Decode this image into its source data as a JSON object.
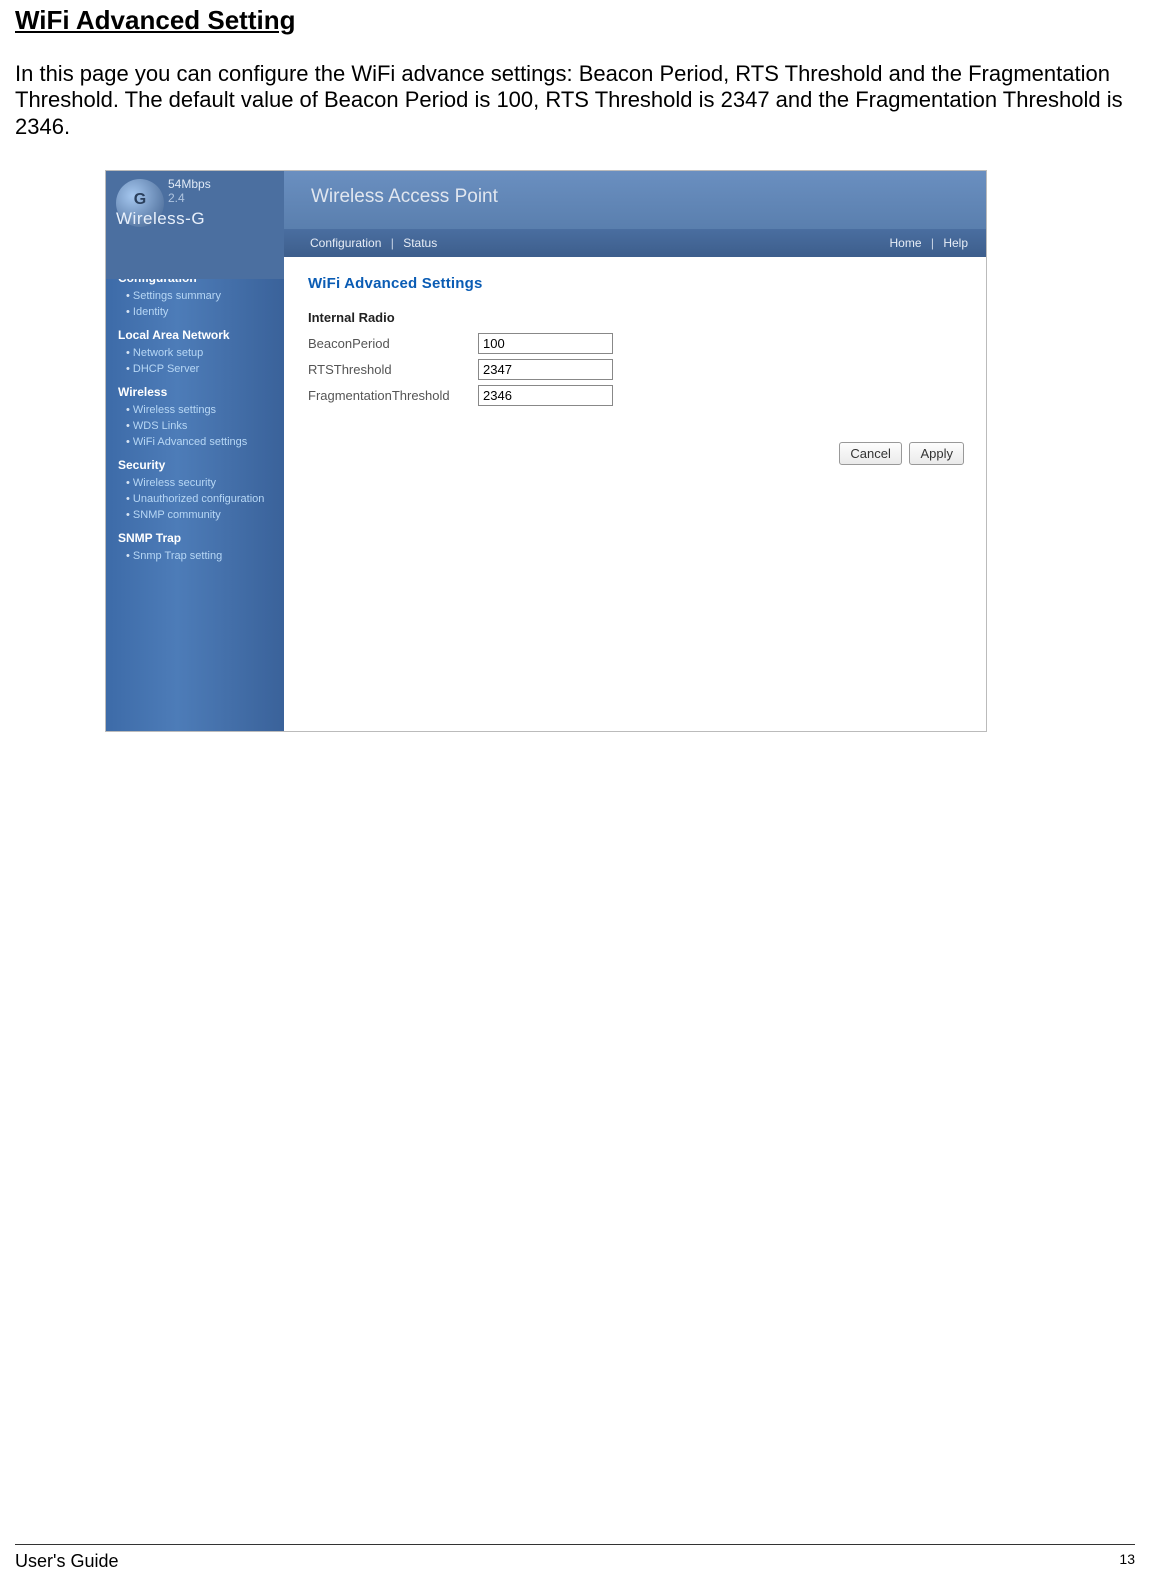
{
  "doc": {
    "title": "WiFi Advanced Setting",
    "description": "In this page you can configure the WiFi advance settings: Beacon Period, RTS Threshold and the Fragmentation Threshold. The default value of Beacon Period is 100, RTS Threshold is 2347 and the Fragmentation Threshold is 2346."
  },
  "screenshot": {
    "header": {
      "product_title": "Wireless Access Point",
      "logo_speed": "54Mbps",
      "logo_band": "2.4",
      "logo_name": "Wireless-G"
    },
    "nav": {
      "left1": "Configuration",
      "left2": "Status",
      "right1": "Home",
      "right2": "Help",
      "sep": "|"
    },
    "sidebar": {
      "sec_config": "Configuration",
      "link_settings_summary": "Settings summary",
      "link_identity": "Identity",
      "sec_lan": "Local Area Network",
      "link_network_setup": "Network setup",
      "link_dhcp": "DHCP Server",
      "sec_wireless": "Wireless",
      "link_wireless_settings": "Wireless settings",
      "link_wds": "WDS Links",
      "link_wifi_adv": "WiFi Advanced settings",
      "sec_security": "Security",
      "link_wireless_sec": "Wireless security",
      "link_unauth": "Unauthorized configuration",
      "link_snmp_comm": "SNMP community",
      "sec_snmp": "SNMP Trap",
      "link_snmp_trap": "Snmp Trap setting"
    },
    "content": {
      "title": "WiFi Advanced Settings",
      "subtitle": "Internal Radio",
      "label_beacon": "BeaconPeriod",
      "value_beacon": "100",
      "label_rts": "RTSThreshold",
      "value_rts": "2347",
      "label_frag": "FragmentationThreshold",
      "value_frag": "2346"
    },
    "buttons": {
      "cancel": "Cancel",
      "apply": "Apply"
    }
  },
  "footer": {
    "guide": "User's Guide",
    "page": "13"
  }
}
